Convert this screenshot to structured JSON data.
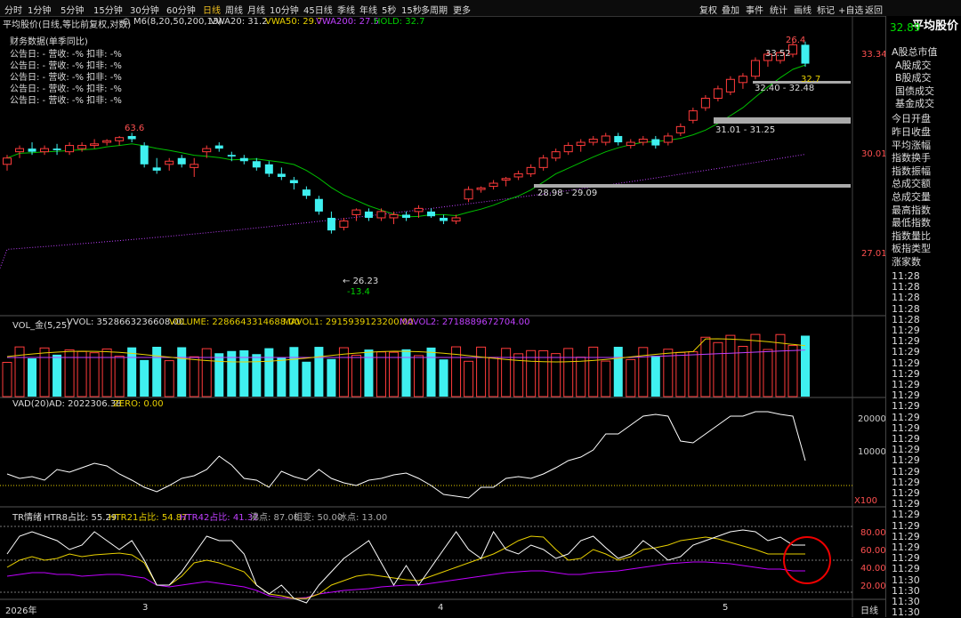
{
  "toolbar": {
    "periods": [
      "分时",
      "1分钟",
      "5分钟",
      "15分钟",
      "30分钟",
      "60分钟",
      "日线",
      "周线",
      "月线",
      "10分钟",
      "45日线",
      "季线",
      "年线",
      "5秒",
      "15秒",
      "多周期",
      "更多"
    ],
    "active": "日线",
    "right_buttons": [
      "复权",
      "叠加",
      "事件",
      "统计",
      "画线",
      "标记",
      "+自选",
      "返回"
    ]
  },
  "main_header": {
    "name": "平均股价(日线,等比前复权,对数)",
    "ma": "M6(8,20,50,200,13)",
    "vwa20": "VWA20: 31.2",
    "vwa50": "VWA50: 29.7",
    "vwa200": "VWA200: 27.5",
    "hold": "HOLD: 32.7"
  },
  "finance": {
    "title": "财务数据(单季同比)",
    "rows": [
      "公告日: -   营收: -%   扣非: -%",
      "公告日: -   营收: -%   扣非: -%",
      "公告日: -   营收: -%   扣非: -%",
      "公告日: -   营收: -%   扣非: -%",
      "公告日: -   营收: -%   扣非: -%"
    ]
  },
  "price_axis": [
    "33.34",
    "30.01",
    "27.01"
  ],
  "annotations": {
    "peak_left": "63.6",
    "peak_right": "26.4",
    "low_price": "26.23",
    "low_pct": "-13.4",
    "res1": "33.52",
    "res1_pct": "32.7",
    "range1": "32.40 - 32.48",
    "range2": "31.01 - 31.25",
    "range3": "28.98 - 29.09"
  },
  "vol_header": {
    "name": "VOL_金(5,25)",
    "vvol": "VVOL: 3528663236608.00",
    "volume": "VOLUME: 2286643314688.00",
    "mavol1": "MAVOL1: 2915939123200.00",
    "mavol2": "MAVOL2: 2718889672704.00"
  },
  "vad_header": {
    "name": "VAD(20)",
    "ad": "AD: 2022306.38",
    "zero": "ZERO: 0.00"
  },
  "vad_axis": [
    "20000",
    "10000"
  ],
  "tr_header": {
    "name": "TR情绪",
    "htr8": "HTR8占比: 55.29",
    "htr21": "HTR21占比: 54.87",
    "htr42": "HTR42占比: 41.32",
    "fei": "沸点: 87.00",
    "xiang": "相变: 50.00",
    "bing": "冰点: 13.00"
  },
  "tr_axis": [
    "80.00",
    "60.00",
    "40.00",
    "20.00"
  ],
  "tr_multiplier": "X100",
  "date_axis": {
    "year": "2026年",
    "m3": "3",
    "m4": "4",
    "m5": "5",
    "period": "日线"
  },
  "right_panel": {
    "title": "平均股价",
    "price": "32.89",
    "items": [
      "A股总市值",
      "A股成交",
      "B股成交",
      "国债成交",
      "基金成交",
      "今日开盘",
      "昨日收盘",
      "平均涨幅",
      "指数换手",
      "指数振幅",
      "总成交额",
      "总成交量",
      "最高指数",
      "最低指数",
      "指数量比",
      "板指类型",
      "涨家数"
    ],
    "times": [
      "11:28",
      "11:28",
      "11:28",
      "11:28",
      "11:28",
      "11:29",
      "11:29",
      "11:29",
      "11:29",
      "11:29",
      "11:29",
      "11:29",
      "11:29",
      "11:29",
      "11:29",
      "11:29",
      "11:29",
      "11:29",
      "11:29",
      "11:29",
      "11:29",
      "11:29",
      "11:29",
      "11:29",
      "11:29",
      "11:29",
      "11:29",
      "11:29",
      "11:30",
      "11:30",
      "11:30",
      "11:30"
    ]
  },
  "colors": {
    "up": "#ff3b3b",
    "down": "#3ff0f0",
    "vwa20": "#00c000",
    "vwa200": "#c040ff",
    "vad": "#ffffff",
    "htr8": "#ffffff",
    "htr21": "#e8d000",
    "htr42": "#c000ff",
    "accent": "#f0c020"
  },
  "chart_data": {
    "type": "candlestick",
    "candles": [
      {
        "o": 29.7,
        "h": 30.0,
        "l": 29.5,
        "c": 29.9
      },
      {
        "o": 30.1,
        "h": 30.3,
        "l": 29.9,
        "c": 30.2
      },
      {
        "o": 30.2,
        "h": 30.4,
        "l": 30.0,
        "c": 30.1
      },
      {
        "o": 30.1,
        "h": 30.3,
        "l": 30.0,
        "c": 30.2
      },
      {
        "o": 30.2,
        "h": 30.35,
        "l": 30.0,
        "c": 30.15
      },
      {
        "o": 30.1,
        "h": 30.4,
        "l": 30.0,
        "c": 30.3
      },
      {
        "o": 30.2,
        "h": 30.4,
        "l": 30.1,
        "c": 30.3
      },
      {
        "o": 30.3,
        "h": 30.5,
        "l": 30.2,
        "c": 30.35
      },
      {
        "o": 30.4,
        "h": 30.5,
        "l": 30.3,
        "c": 30.45
      },
      {
        "o": 30.45,
        "h": 30.6,
        "l": 30.3,
        "c": 30.55
      },
      {
        "o": 30.6,
        "h": 30.7,
        "l": 30.4,
        "c": 30.5
      },
      {
        "o": 30.3,
        "h": 30.4,
        "l": 29.6,
        "c": 29.7
      },
      {
        "o": 29.6,
        "h": 29.9,
        "l": 29.4,
        "c": 29.5
      },
      {
        "o": 29.7,
        "h": 29.9,
        "l": 29.5,
        "c": 29.8
      },
      {
        "o": 29.9,
        "h": 30.0,
        "l": 29.6,
        "c": 29.7
      },
      {
        "o": 29.6,
        "h": 29.9,
        "l": 29.3,
        "c": 29.7
      },
      {
        "o": 30.1,
        "h": 30.3,
        "l": 29.9,
        "c": 30.2
      },
      {
        "o": 30.3,
        "h": 30.4,
        "l": 30.1,
        "c": 30.2
      },
      {
        "o": 30.0,
        "h": 30.1,
        "l": 29.8,
        "c": 29.95
      },
      {
        "o": 29.9,
        "h": 30.0,
        "l": 29.7,
        "c": 29.8
      },
      {
        "o": 29.8,
        "h": 29.9,
        "l": 29.5,
        "c": 29.6
      },
      {
        "o": 29.7,
        "h": 29.8,
        "l": 29.3,
        "c": 29.4
      },
      {
        "o": 29.4,
        "h": 29.6,
        "l": 29.2,
        "c": 29.3
      },
      {
        "o": 29.2,
        "h": 29.3,
        "l": 28.9,
        "c": 29.1
      },
      {
        "o": 28.9,
        "h": 29.0,
        "l": 28.6,
        "c": 28.7
      },
      {
        "o": 28.6,
        "h": 28.7,
        "l": 28.1,
        "c": 28.2
      },
      {
        "o": 28.0,
        "h": 28.2,
        "l": 27.5,
        "c": 27.6
      },
      {
        "o": 27.7,
        "h": 28.0,
        "l": 27.6,
        "c": 27.9
      },
      {
        "o": 28.1,
        "h": 28.3,
        "l": 27.9,
        "c": 28.25
      },
      {
        "o": 28.2,
        "h": 28.3,
        "l": 27.9,
        "c": 28.0
      },
      {
        "o": 28.0,
        "h": 28.3,
        "l": 27.9,
        "c": 28.2
      },
      {
        "o": 28.0,
        "h": 28.2,
        "l": 27.8,
        "c": 28.1
      },
      {
        "o": 28.1,
        "h": 28.2,
        "l": 27.9,
        "c": 28.0
      },
      {
        "o": 28.2,
        "h": 28.4,
        "l": 28.0,
        "c": 28.3
      },
      {
        "o": 28.2,
        "h": 28.3,
        "l": 28.0,
        "c": 28.05
      },
      {
        "o": 28.0,
        "h": 28.1,
        "l": 27.8,
        "c": 27.9
      },
      {
        "o": 27.9,
        "h": 28.1,
        "l": 27.8,
        "c": 28.0
      },
      {
        "o": 28.6,
        "h": 29.0,
        "l": 28.5,
        "c": 28.9
      },
      {
        "o": 28.9,
        "h": 29.0,
        "l": 28.8,
        "c": 28.95
      },
      {
        "o": 29.0,
        "h": 29.2,
        "l": 28.9,
        "c": 29.1
      },
      {
        "o": 29.2,
        "h": 29.3,
        "l": 29.0,
        "c": 29.25
      },
      {
        "o": 29.3,
        "h": 29.5,
        "l": 29.2,
        "c": 29.4
      },
      {
        "o": 29.4,
        "h": 29.7,
        "l": 29.3,
        "c": 29.6
      },
      {
        "o": 29.6,
        "h": 30.0,
        "l": 29.5,
        "c": 29.9
      },
      {
        "o": 29.9,
        "h": 30.2,
        "l": 29.8,
        "c": 30.1
      },
      {
        "o": 30.1,
        "h": 30.4,
        "l": 30.0,
        "c": 30.3
      },
      {
        "o": 30.3,
        "h": 30.5,
        "l": 30.1,
        "c": 30.4
      },
      {
        "o": 30.4,
        "h": 30.6,
        "l": 30.3,
        "c": 30.5
      },
      {
        "o": 30.4,
        "h": 30.7,
        "l": 30.3,
        "c": 30.6
      },
      {
        "o": 30.6,
        "h": 30.7,
        "l": 30.3,
        "c": 30.4
      },
      {
        "o": 30.3,
        "h": 30.5,
        "l": 30.2,
        "c": 30.4
      },
      {
        "o": 30.4,
        "h": 30.6,
        "l": 30.3,
        "c": 30.5
      },
      {
        "o": 30.5,
        "h": 30.6,
        "l": 30.2,
        "c": 30.3
      },
      {
        "o": 30.4,
        "h": 30.7,
        "l": 30.3,
        "c": 30.6
      },
      {
        "o": 30.7,
        "h": 31.0,
        "l": 30.6,
        "c": 30.9
      },
      {
        "o": 31.1,
        "h": 31.5,
        "l": 31.0,
        "c": 31.4
      },
      {
        "o": 31.5,
        "h": 31.9,
        "l": 31.4,
        "c": 31.8
      },
      {
        "o": 31.8,
        "h": 32.2,
        "l": 31.7,
        "c": 32.1
      },
      {
        "o": 32.0,
        "h": 32.5,
        "l": 31.9,
        "c": 32.4
      },
      {
        "o": 32.3,
        "h": 32.6,
        "l": 32.1,
        "c": 32.5
      },
      {
        "o": 32.5,
        "h": 33.1,
        "l": 32.4,
        "c": 33.0
      },
      {
        "o": 33.0,
        "h": 33.3,
        "l": 32.8,
        "c": 33.2
      },
      {
        "o": 33.0,
        "h": 33.3,
        "l": 32.9,
        "c": 33.25
      },
      {
        "o": 33.2,
        "h": 33.6,
        "l": 33.1,
        "c": 33.5
      },
      {
        "o": 33.5,
        "h": 33.6,
        "l": 32.8,
        "c": 32.9
      }
    ]
  }
}
